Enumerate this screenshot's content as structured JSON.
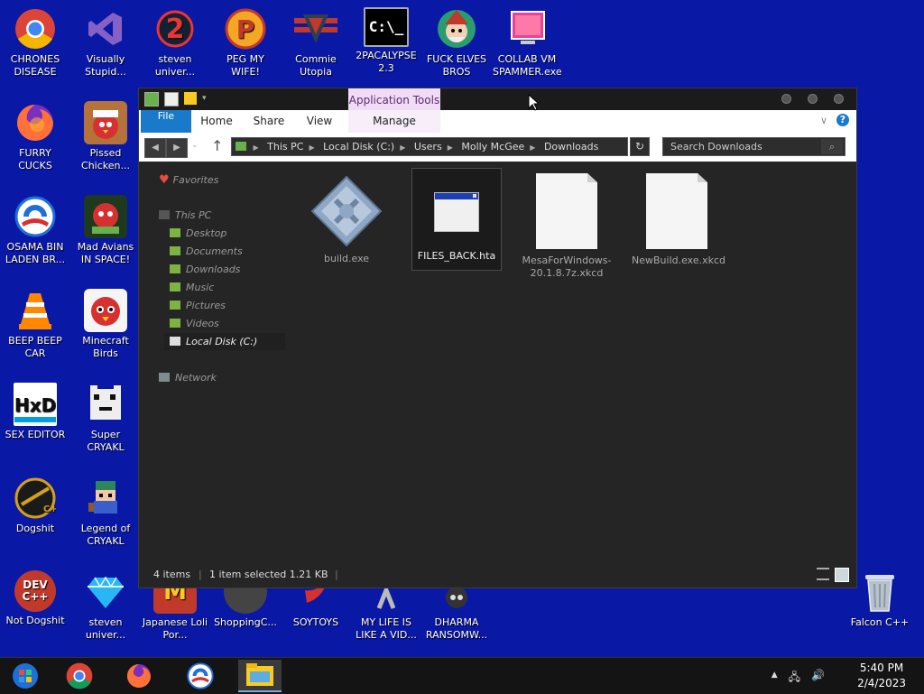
{
  "desktop_icons": [
    {
      "label": "CHRONES DISEASE",
      "icon": "chrome-icon"
    },
    {
      "label": "Visually Stupid...",
      "icon": "visual-studio-icon"
    },
    {
      "label": "steven univer...",
      "icon": "number-two-icon"
    },
    {
      "label": "PEG MY WIFE!",
      "icon": "p-ball-icon"
    },
    {
      "label": "Commie Utopia",
      "icon": "commie-logo-icon"
    },
    {
      "label": "2PACALYPSE 2.3",
      "icon": "cmd-icon"
    },
    {
      "label": "FUCK ELVES BROS",
      "icon": "elf-icon"
    },
    {
      "label": "COLLAB VM SPAMMER.exe",
      "icon": "monitor-icon"
    },
    {
      "label": "FURRY CUCKS",
      "icon": "firefox-icon"
    },
    {
      "label": "Pissed Chicken...",
      "icon": "angry-birds-seasons-icon"
    },
    {
      "label": "OSAMA BIN LADEN BR...",
      "icon": "obama-logo-icon"
    },
    {
      "label": "Mad Avians IN SPACE!",
      "icon": "angry-birds-space-icon"
    },
    {
      "label": "BEEP BEEP CAR",
      "icon": "vlc-cone-icon"
    },
    {
      "label": "Minecraft Birds",
      "icon": "angry-bird-icon"
    },
    {
      "label": "SEX EDITOR",
      "icon": "hxd-icon"
    },
    {
      "label": "Super CRYAKL",
      "icon": "pixel-cat-icon"
    },
    {
      "label": "Dogshit",
      "icon": "cpp-icon"
    },
    {
      "label": "Legend of CRYAKL",
      "icon": "pixel-hero-icon"
    },
    {
      "label": "Not Dogshit",
      "icon": "dev-cpp-icon"
    },
    {
      "label": "steven univer...",
      "icon": "diamond-icon"
    },
    {
      "label": "Japanese Loli Por...",
      "icon": "mcdonalds-icon"
    },
    {
      "label": "ShoppingC...",
      "icon": "app-icon"
    },
    {
      "label": "SOYTOYS",
      "icon": "red-logo-icon"
    },
    {
      "label": "MY LIFE IS LIKE A VID...",
      "icon": "app-icon-2"
    },
    {
      "label": "DHARMA RANSOMW...",
      "icon": "skull-icon"
    },
    {
      "label": "Falcon C++",
      "icon": "recycle-bin-icon"
    }
  ],
  "dev_cpp_text": "DEV C++",
  "cmd_text": "C:\\_",
  "explorer": {
    "context_tab": "Application Tools",
    "ribbon_tabs": {
      "file": "File",
      "home": "Home",
      "share": "Share",
      "view": "View",
      "manage": "Manage"
    },
    "help": "?",
    "address": [
      "This PC",
      "Local Disk (C:)",
      "Users",
      "Molly McGee",
      "Downloads"
    ],
    "search_placeholder": "Search Downloads",
    "nav": {
      "favorites": "Favorites",
      "this_pc": "This PC",
      "desktop": "Desktop",
      "documents": "Documents",
      "downloads": "Downloads",
      "music": "Music",
      "pictures": "Pictures",
      "videos": "Videos",
      "local_disk": "Local Disk (C:)",
      "network": "Network"
    },
    "files": [
      {
        "name": "build.exe"
      },
      {
        "name": "FILES_BACK.hta"
      },
      {
        "name": "MesaForWindows-20.1.8.7z.xkcd"
      },
      {
        "name": "NewBuild.exe.xkcd"
      }
    ],
    "status": {
      "count": "4 items",
      "selection": "1 item selected  1.21 KB"
    }
  },
  "taskbar": {
    "time": "5:40 PM",
    "date": "2/4/2023"
  }
}
